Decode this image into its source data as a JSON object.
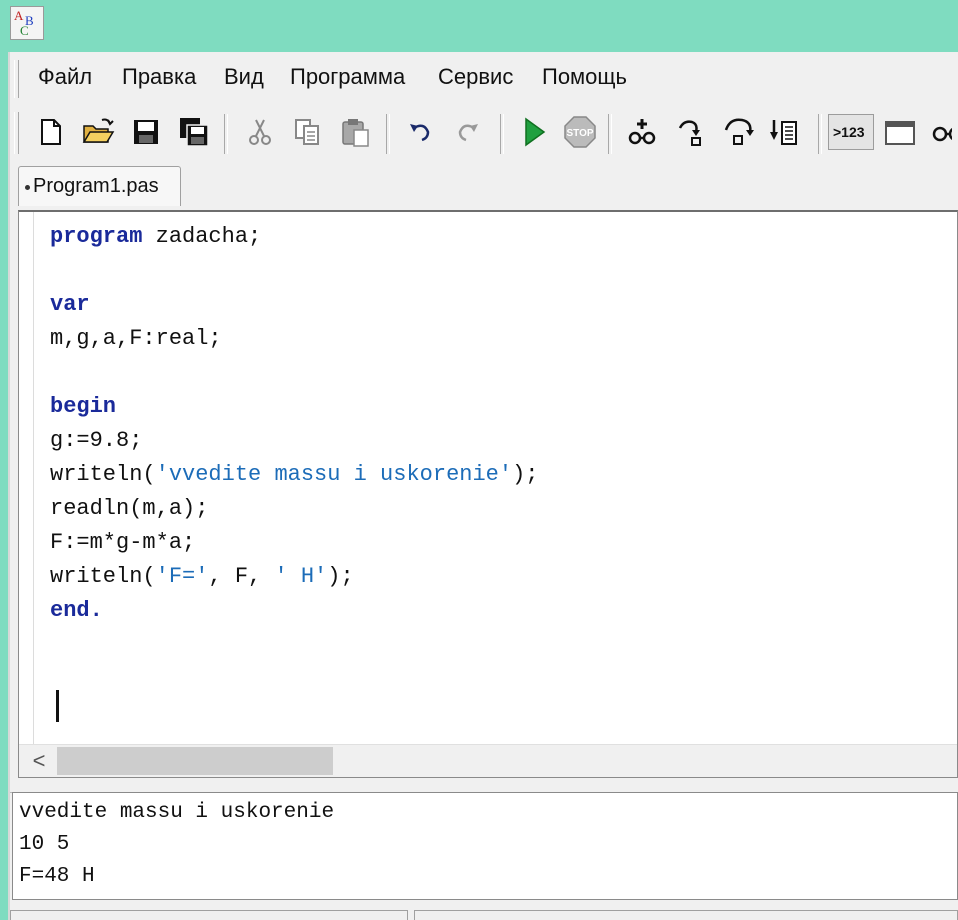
{
  "app": {
    "icon_letters": [
      "A",
      "B",
      "C"
    ]
  },
  "menu": {
    "items": [
      "Файл",
      "Правка",
      "Вид",
      "Программа",
      "Сервис",
      "Помощь"
    ]
  },
  "toolbar": {
    "buttons": [
      "new-file-icon",
      "open-folder-icon",
      "save-icon",
      "save-all-icon",
      "cut-icon",
      "copy-icon",
      "paste-icon",
      "undo-icon",
      "redo-icon",
      "run-icon",
      "stop-icon",
      "add-watch-icon",
      "step-into-icon",
      "step-over-icon",
      "run-to-cursor-icon",
      "output-window-icon",
      "form-window-icon",
      "debug-window-icon"
    ],
    "output_button_label": ">123"
  },
  "tab": {
    "label": "Program1.pas"
  },
  "editor": {
    "lines": [
      [
        {
          "t": "program",
          "c": "kw"
        },
        {
          "t": " zadacha;"
        }
      ],
      [],
      [
        {
          "t": "var",
          "c": "kw"
        }
      ],
      [
        {
          "t": "m,g,a,F:real;"
        }
      ],
      [],
      [
        {
          "t": "begin",
          "c": "kw"
        }
      ],
      [
        {
          "t": "g:=9.8;"
        }
      ],
      [
        {
          "t": "writeln("
        },
        {
          "t": "'vvedite massu i uskorenie'",
          "c": "str"
        },
        {
          "t": ");"
        }
      ],
      [
        {
          "t": "readln(m,a);"
        }
      ],
      [
        {
          "t": "F:=m*g-m*a;"
        }
      ],
      [
        {
          "t": "writeln("
        },
        {
          "t": "'F='",
          "c": "str"
        },
        {
          "t": ", F, "
        },
        {
          "t": "' H'",
          "c": "str"
        },
        {
          "t": ");"
        }
      ],
      [
        {
          "t": "end.",
          "c": "kw"
        }
      ]
    ],
    "scroll_left_glyph": "<"
  },
  "output": {
    "lines": [
      "vvedite massu i uskorenie",
      "10 5",
      "F=48 H"
    ]
  },
  "colors": {
    "background": "#7fdcc0",
    "keyword": "#1a2a9a",
    "string": "#1c6cb8"
  }
}
